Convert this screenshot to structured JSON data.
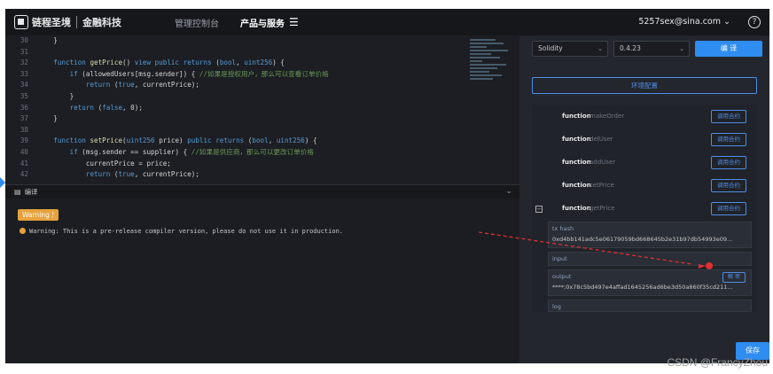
{
  "header": {
    "brand_left": "链程圣境",
    "brand_right": "金融科技",
    "nav": [
      "管理控制台",
      "产品与服务"
    ],
    "menu_icon": "☰",
    "user": "5257sex@sina.com",
    "user_icon": "chevron-down-icon",
    "help_icon": "question-circle-icon"
  },
  "editor": {
    "lines": [
      {
        "n": "30",
        "t": "    }"
      },
      {
        "n": "31",
        "t": ""
      },
      {
        "n": "32",
        "t": "    function getPrice() view public returns (bool, uint256) {"
      },
      {
        "n": "33",
        "t": "        if (allowedUsers[msg.sender]) { //如果是授权用户，那么可以查看订单价格"
      },
      {
        "n": "34",
        "t": "            return (true, currentPrice);"
      },
      {
        "n": "35",
        "t": "        }"
      },
      {
        "n": "36",
        "t": "        return (false, 0);"
      },
      {
        "n": "37",
        "t": "    }"
      },
      {
        "n": "38",
        "t": ""
      },
      {
        "n": "39",
        "t": "    function setPrice(uint256 price) public returns (bool, uint256) {"
      },
      {
        "n": "40",
        "t": "        if (msg.sender == supplier) { //如果是供应商，那么可以更改订单价格"
      },
      {
        "n": "41",
        "t": "            currentPrice = price;"
      },
      {
        "n": "42",
        "t": "            return (true, currentPrice);"
      }
    ]
  },
  "compile_panel": {
    "title": "编译",
    "warning_badge": "Warning !",
    "warning_text": "Warning: This is a pre-release compiler version, please do not use it in production."
  },
  "right_panel": {
    "language": "Solidity",
    "version": "0.4.23",
    "compile_label": "编 译",
    "env_config": "环境配置",
    "function_keyword": "function",
    "call_label": "调用合约",
    "functions": [
      {
        "name": "makeOrder",
        "expanded": false
      },
      {
        "name": "delUser",
        "expanded": false
      },
      {
        "name": "addUser",
        "expanded": false
      },
      {
        "name": "setPrice",
        "expanded": false
      },
      {
        "name": "getPrice",
        "expanded": true
      }
    ],
    "tx_hash_label": "tx hash",
    "tx_hash_value": "0xd4bb141adc5e06179059bd668645b2e31b97db54993e09...",
    "input_label": "input",
    "output_label": "output",
    "output_value": "****;0x78c5bd497e4affad1645256ad6be3d50a860f35cd211...",
    "decode_label": "解 密",
    "log_label": "log",
    "save_label": "保存"
  },
  "footer_watermark": "CSDN @FrancyZhou"
}
